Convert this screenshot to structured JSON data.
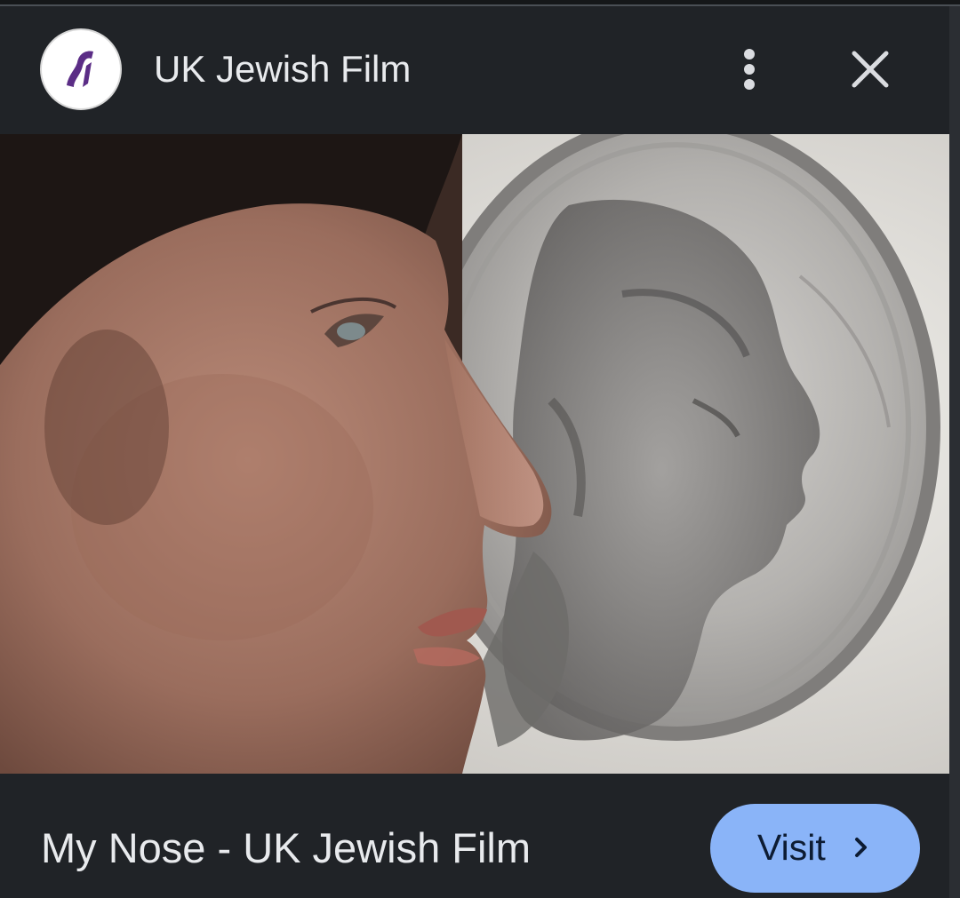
{
  "header": {
    "site_title": "UK Jewish Film",
    "logo_icon": "uk-jewish-film-logo",
    "more_icon": "more-vert-icon",
    "close_icon": "close-icon"
  },
  "image": {
    "lens_icon": "google-lens-icon"
  },
  "footer": {
    "page_title": "My Nose - UK Jewish Film",
    "visit_label": "Visit",
    "visit_icon": "chevron-right-icon"
  },
  "colors": {
    "background": "#202327",
    "text": "#e8eaed",
    "visit_button": "#8ab4f8",
    "visit_text": "#0d1c33",
    "logo_accent": "#5b2d86"
  }
}
